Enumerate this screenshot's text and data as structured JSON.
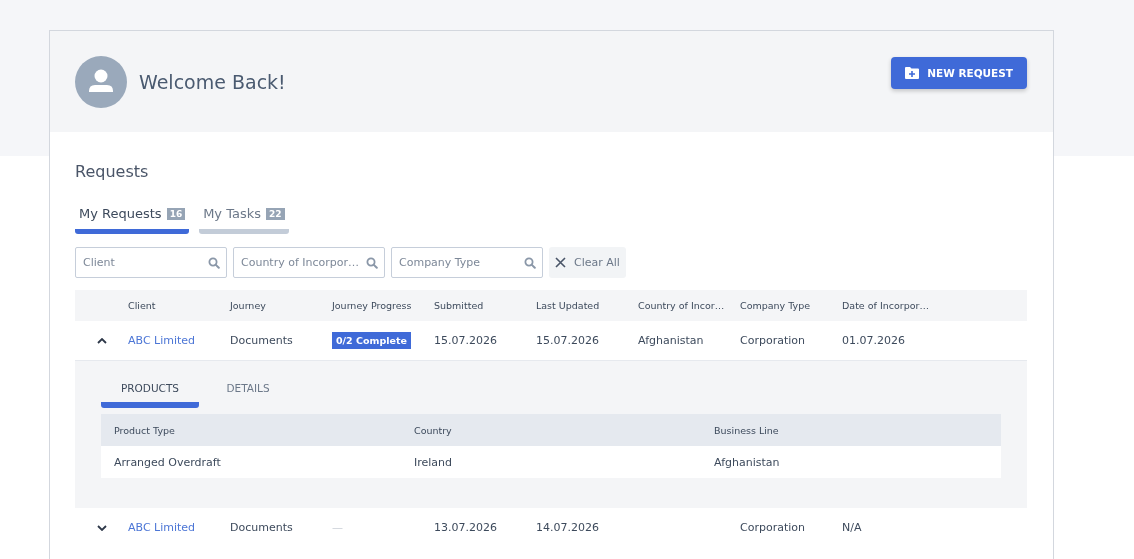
{
  "header": {
    "greeting": "Welcome Back!",
    "new_request_button": "NEW REQUEST"
  },
  "requests": {
    "title": "Requests",
    "tabs": [
      {
        "label": "My Requests",
        "count": "16",
        "selected": true
      },
      {
        "label": "My Tasks",
        "count": "22",
        "selected": false
      }
    ],
    "filters": [
      {
        "placeholder": "Client"
      },
      {
        "placeholder": "Country of Incorpor…"
      },
      {
        "placeholder": "Company Type"
      }
    ],
    "clear_all": "Clear All",
    "table": {
      "columns": [
        "Client",
        "Journey",
        "Journey Progress",
        "Submitted",
        "Last Updated",
        "Country of Incor…",
        "Company Type",
        "Date of Incorpor…"
      ],
      "rows": [
        {
          "expanded": true,
          "client": "ABC Limited",
          "journey": "Documents",
          "progress": {
            "kind": "badge",
            "text": "0/2 Complete"
          },
          "submitted": "15.07.2026",
          "last_updated": "15.07.2026",
          "country": "Afghanistan",
          "company_type": "Corporation",
          "date_of_incorporation": "01.07.2026",
          "detail": {
            "tabs": [
              {
                "label": "PRODUCTS",
                "selected": true
              },
              {
                "label": "DETAILS",
                "selected": false
              }
            ],
            "columns": [
              "Product Type",
              "Country",
              "Business Line"
            ],
            "rows": [
              [
                "Arranged Overdraft",
                "Ireland",
                "Afghanistan"
              ]
            ]
          }
        },
        {
          "expanded": false,
          "client": "ABC Limited",
          "journey": "Documents",
          "progress": {
            "kind": "dash",
            "text": "—"
          },
          "submitted": "13.07.2026",
          "last_updated": "14.07.2026",
          "country": "",
          "company_type": "Corporation",
          "date_of_incorporation": "N/A"
        }
      ]
    }
  }
}
